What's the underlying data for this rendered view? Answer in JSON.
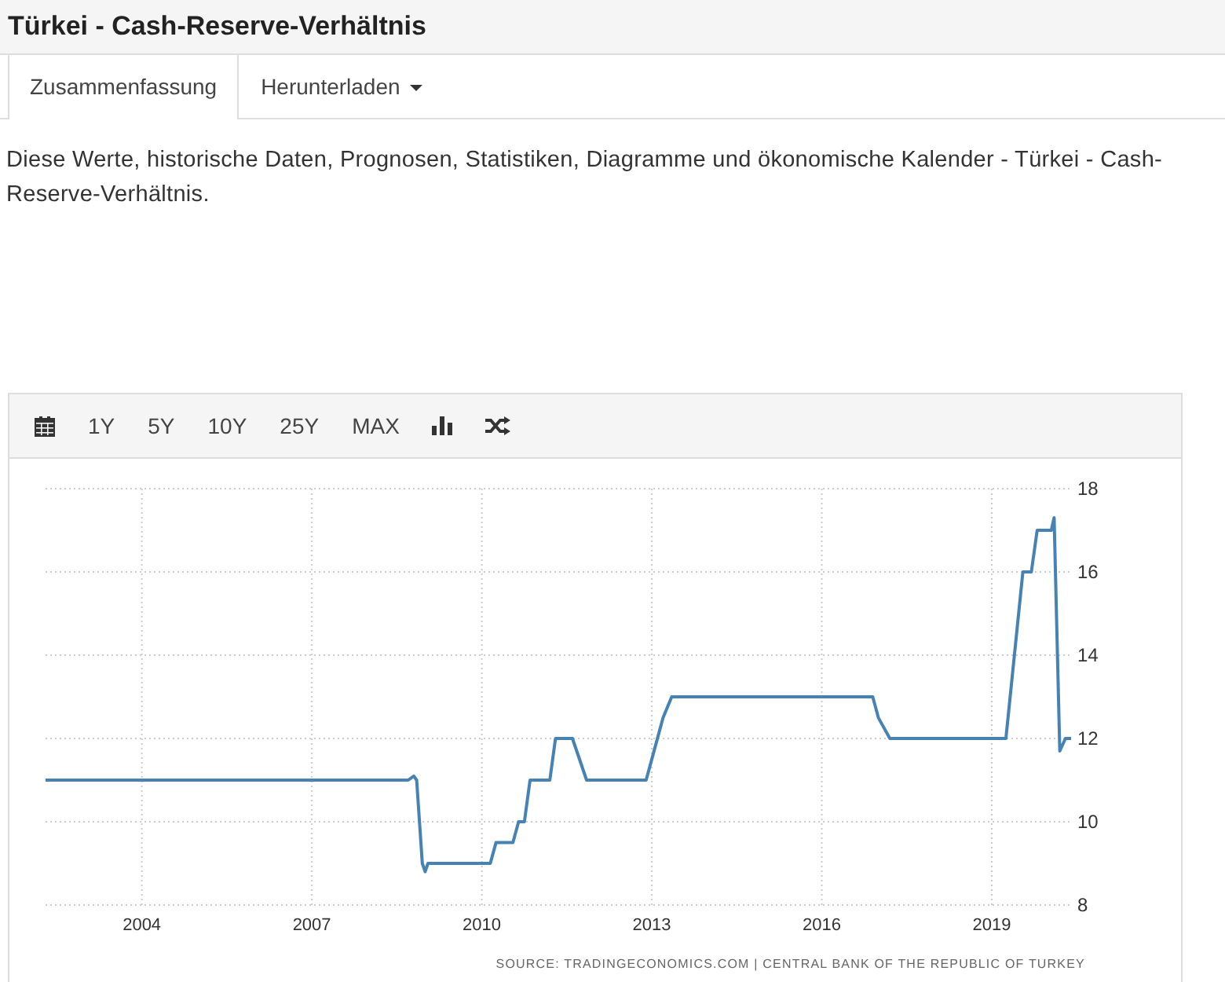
{
  "title": "Türkei - Cash-Reserve-Verhältnis",
  "tabs": [
    {
      "label": "Zusammenfassung",
      "selected": true,
      "dropdown": false
    },
    {
      "label": "Herunterladen",
      "selected": false,
      "dropdown": true
    }
  ],
  "description": "Diese Werte, historische Daten, Prognosen, Statistiken, Diagramme und ökonomische Kalender - Türkei - Cash-Reserve-Verhältnis.",
  "toolbar": [
    {
      "kind": "calendar"
    },
    {
      "kind": "text",
      "label": "1Y"
    },
    {
      "kind": "text",
      "label": "5Y"
    },
    {
      "kind": "text",
      "label": "10Y"
    },
    {
      "kind": "text",
      "label": "25Y"
    },
    {
      "kind": "text",
      "label": "MAX"
    },
    {
      "kind": "bars"
    },
    {
      "kind": "shuffle"
    }
  ],
  "chart": {
    "chart_data": {
      "type": "line",
      "x": [
        2002.3,
        2008.7,
        2008.8,
        2008.85,
        2008.95,
        2009.0,
        2009.05,
        2010.15,
        2010.25,
        2010.55,
        2010.65,
        2010.75,
        2010.85,
        2011.2,
        2011.3,
        2011.6,
        2011.85,
        2012.9,
        2013.0,
        2013.2,
        2013.35,
        2016.9,
        2017.0,
        2017.2,
        2019.25,
        2019.4,
        2019.55,
        2019.7,
        2019.8,
        2020.05,
        2020.1,
        2020.2,
        2020.3,
        2020.4
      ],
      "series": [
        {
          "color": "#4682b4",
          "values": [
            11,
            11,
            11.1,
            11,
            9,
            8.8,
            9,
            9,
            9.5,
            9.5,
            10,
            10,
            11,
            11,
            12,
            12,
            11,
            11,
            11.5,
            12.5,
            13,
            13,
            12.5,
            12,
            12,
            14,
            16,
            16,
            17,
            17,
            17.3,
            11.7,
            12,
            12
          ]
        }
      ],
      "xlim": [
        2002.3,
        2020.4
      ],
      "ylim": [
        8,
        18
      ],
      "grid": true,
      "xticks": [
        2004,
        2007,
        2010,
        2013,
        2016,
        2019
      ],
      "yticks": [
        8,
        10,
        12,
        14,
        16,
        18
      ]
    },
    "source": "SOURCE: TRADINGECONOMICS.COM | CENTRAL BANK OF THE REPUBLIC OF TURKEY"
  }
}
